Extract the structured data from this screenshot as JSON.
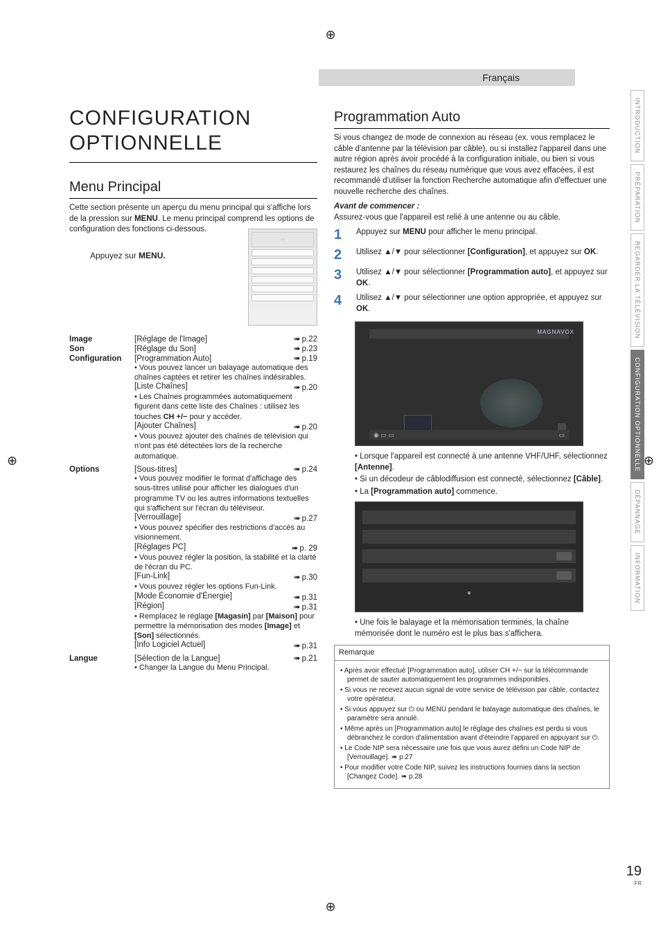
{
  "lang_bar": "Français",
  "title_l1": "CONFIGURATION",
  "title_l2": "OPTIONNELLE",
  "left": {
    "section1": "Menu Principal",
    "intro": "Cette section présente un aperçu du menu principal qui s'affiche lors de la pression sur ",
    "intro_bold": "MENU",
    "intro2": ". Le menu principal comprend les options de configuration des fonctions ci-dessous.",
    "press": "Appuyez sur ",
    "press_bold": "MENU.",
    "image_key": "Image",
    "image_label": "[Réglage de l'Image]",
    "image_page": "p.22",
    "son_key": "Son",
    "son_label": "[Réglage du Son]",
    "son_page": "p.23",
    "conf_key": "Configuration",
    "conf_label": "[Programmation Auto]",
    "conf_page": "p.19",
    "conf_b1": "Vous pouvez lancer un balayage automatique des chaînes captées et retirer les chaînes indésirables.",
    "liste_label": "[Liste Chaînes]",
    "liste_page": "p.20",
    "liste_b": "Les Chaînes programmées automatiquement figurent dans cette liste des Chaînes : utilisez les touches ",
    "liste_bold": "CH +/−",
    "liste_tail": " pour y accéder.",
    "ajout_label": "[Ajouter Chaînes]",
    "ajout_page": "p.20",
    "ajout_b": "Vous pouvez ajouter des chaînes de télévision qui n'ont pas été détectées lors de la recherche automatique.",
    "opt_key": "Options",
    "st_label": "[Sous-titres]",
    "st_page": "p.24",
    "st_b": "Vous pouvez modifier le format d'affichage des sous-titres utilisé pour afficher les dialogues d'un programme TV ou les autres informations textuelles qui s'affichent sur l'écran du téléviseur.",
    "ver_label": "[Verrouillage]",
    "ver_page": "p.27",
    "ver_b": "Vous pouvez spécifier des restrictions d'accès au visionnement.",
    "pc_label": "[Réglages PC]",
    "pc_page": "p. 29",
    "pc_b": "Vous pouvez régler la position, la stabilité et la clarté de l'écran du PC.",
    "fun_label": "[Fun-Link]",
    "fun_page": "p.30",
    "fun_b": "Vous pouvez régler les options Fun-Link.",
    "eco_label": "[Mode Économie d'Énergie]",
    "eco_page": "p.31",
    "reg_label": "[Région]",
    "reg_page": "p.31",
    "reg_b1": "Remplacez le réglage ",
    "reg_bold1": "[Magasin]",
    "reg_mid": " par ",
    "reg_bold2": "[Maison]",
    "reg_tail": " pour permettre la mémorisation des modes ",
    "reg_bold3": "[Image]",
    "reg_and": " et ",
    "reg_bold4": "[Son]",
    "reg_end": " sélectionnés.",
    "info_label": "[Info Logiciel Actuel]",
    "info_page": "p.31",
    "lang_key": "Langue",
    "lang_label": "[Sélection de la Langue]",
    "lang_page": "p.21",
    "lang_b": "Changer la Langue du Menu Principal."
  },
  "right": {
    "section": "Programmation Auto",
    "p1": "Si vous changez de mode de connexion au réseau (ex. vous remplacez le câble d'antenne par la télévision par câble), ou si installez l'appareil dans une autre région après avoir procédé à la configuration initiale, ou bien si vous restaurez les chaînes du réseau numérique que vous avez effacées, il est recommandé d'utiliser la fonction Recherche automatique afin d'effectuer une nouvelle recherche des chaînes.",
    "before_head": "Avant de commencer :",
    "before_text": "Assurez-vous que l'appareil est relié à une antenne ou au câble.",
    "steps": [
      {
        "n": "1",
        "t1": "Appuyez sur ",
        "b": "MENU",
        "t2": " pour afficher le menu principal."
      },
      {
        "n": "2",
        "t1": "Utilisez ▲/▼ pour sélectionner ",
        "b": "[Configuration]",
        "t2": ", et appuyez sur ",
        "b2": "OK",
        "t3": "."
      },
      {
        "n": "3",
        "t1": "Utilisez ▲/▼ pour sélectionner ",
        "b": "[Programmation auto]",
        "t2": ", et appuyez sur ",
        "b2": "OK",
        "t3": "."
      },
      {
        "n": "4",
        "t1": "Utilisez ▲/▼ pour sélectionner une option appropriée, et appuyez sur ",
        "b": "OK",
        "t2": "."
      }
    ],
    "brand": "MAGNAVOX",
    "b1a": "Lorsque l'appareil est connecté à une antenne VHF/UHF, sélectionnez ",
    "b1b": "[Antenne]",
    "b2a": "Si un décodeur de câblodiffusion est connecté, sélectionnez ",
    "b2b": "[Câble]",
    "b3a": "La ",
    "b3b": "[Programmation auto]",
    "b3c": " commence.",
    "after": "Une fois le balayage et la mémorisation terminés, la chaîne mémorisée dont le numéro est le plus bas s'affichera.",
    "rem_head": "Remarque",
    "rem": [
      "Après avoir effectué [Programmation auto], utiliser CH +/− sur la télécommande permet de sauter automatiquement les programmes indisponibles.",
      "Si vous ne recevez aucun signal de votre service de télévision par câble, contactez votre opérateur.",
      "Si vous appuyez sur ⏻ ou MENU pendant le balayage automatique des chaînes, le paramètre sera annulé.",
      "Même après un [Programmation auto] le réglage des chaînes est perdu si vous débranchez le cordon d'alimentation avant d'éteindre l'appareil en appuyant sur ⏻.",
      "Le Code NIP sera nécessaire une fois que vous aurez défini un Code NIP de [Verrouillage]. ➠ p.27",
      "Pour modifier votre Code NIP, suivez les instructions fournies dans la section [Changez Code]. ➠ p.28"
    ]
  },
  "tabs": [
    "INTRODUCTION",
    "PRÉPARATION",
    "REGARDER LA TÉLÉVISION",
    "CONFIGURATION OPTIONNELLE",
    "DÉPANNAGE",
    "INFORMATION"
  ],
  "pagenum": "19",
  "pagenum_sub": "FR"
}
